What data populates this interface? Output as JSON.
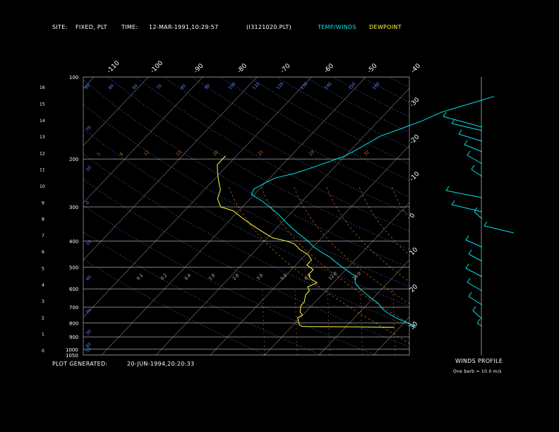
{
  "header": {
    "site_label": "SITE:",
    "site_value": "FIXED, PLT",
    "time_label": "TIME:",
    "time_value": "12-MAR-1991,10:29:57",
    "file": "(I3121020.PLT)",
    "temp_label": "TEMP/WINDS",
    "dew_label": "DEWPOINT"
  },
  "footer": {
    "generated_label": "PLOT GENERATED:",
    "generated_value": "20-JUN-1994,20:20:33"
  },
  "winds": {
    "title": "WINDS PROFILE",
    "note": "One barb = 10.0 m/s"
  },
  "colors": {
    "temp": "#00e5ee",
    "dew": "#ffff40",
    "isobar": "#c8c8c8",
    "isotherm": "#c8c8c8",
    "dry_adiabat": "#5b8cff",
    "moist_adiabat": "#d2691e",
    "mixing_ratio": "#d2691e",
    "background": "#000000"
  },
  "chart_data": {
    "type": "line",
    "title": "",
    "xlabel": "",
    "ylabel": "",
    "y_scale": "log-pressure",
    "pressure_levels": [
      100,
      200,
      300,
      400,
      500,
      600,
      700,
      800,
      900,
      1000,
      1050
    ],
    "height_ticks": [
      "0",
      "1",
      "2",
      "3",
      "4",
      "5",
      "6",
      "7",
      "8",
      "9",
      "10",
      "11",
      "12",
      "13",
      "14",
      "15",
      "16"
    ],
    "top_temp_ticks": [
      "-110",
      "-100",
      "-90",
      "-80",
      "-70",
      "-60",
      "-50",
      "-40"
    ],
    "right_temp_ticks": [
      "-30",
      "-20",
      "-10",
      "0",
      "10",
      "20",
      "30"
    ],
    "dry_adiabat_labels": [
      "90",
      "80",
      "60",
      "70",
      "80",
      "90",
      "100",
      "110",
      "120",
      "130",
      "140",
      "150",
      "160"
    ],
    "moist_adiabat_labels": [
      "5",
      "8",
      "12",
      "15",
      "20",
      "25",
      "29",
      "32"
    ],
    "mixing_ratio_labels": [
      "0.1",
      "0.2",
      "0.4",
      "1.0",
      "2.0",
      "3.0",
      "5.0",
      "8.0",
      "12.0",
      "20.0"
    ],
    "series": [
      {
        "name": "TEMP/WINDS",
        "pressure": [
          830,
          828,
          822,
          815,
          808,
          800,
          792,
          782,
          765,
          745,
          725,
          700,
          680,
          660,
          640,
          620,
          600,
          585,
          570,
          555,
          540,
          520,
          500,
          480,
          460,
          440,
          420,
          400,
          380,
          360,
          340,
          320,
          300,
          285,
          270,
          258,
          245,
          235,
          225,
          215,
          205,
          195,
          185,
          175,
          165,
          155,
          145,
          135,
          125,
          118
        ],
        "temperature": [
          -7,
          -7.5,
          -7.5,
          -8,
          -8.5,
          -9.5,
          -10,
          -11,
          -12.5,
          -14,
          -15.5,
          -17,
          -18,
          -19.5,
          -21,
          -22.5,
          -24,
          -25,
          -26,
          -26.5,
          -27,
          -29,
          -31,
          -33,
          -35,
          -37.5,
          -40,
          -42,
          -44.5,
          -47,
          -49.5,
          -52,
          -55,
          -57.5,
          -60.5,
          -61,
          -60,
          -59,
          -56,
          -54,
          -52,
          -50,
          -49,
          -48,
          -47,
          -44.5,
          -42,
          -40,
          -36,
          -33
        ]
      },
      {
        "name": "DEWPOINT",
        "pressure": [
          830,
          828,
          825,
          820,
          810,
          795,
          780,
          765,
          750,
          730,
          710,
          690,
          670,
          650,
          630,
          610,
          590,
          570,
          550,
          530,
          510,
          500,
          490,
          470,
          450,
          430,
          410,
          400,
          390,
          370,
          350,
          330,
          310,
          300,
          280,
          260,
          240,
          230,
          220,
          210,
          200,
          195
        ],
        "temperature": [
          -11,
          -16,
          -28,
          -28.5,
          -29,
          -29.5,
          -30,
          -30.5,
          -30,
          -31,
          -31.5,
          -32,
          -32,
          -32.5,
          -33,
          -33,
          -34,
          -33,
          -35,
          -36,
          -36,
          -37,
          -38,
          -38,
          -39.5,
          -42,
          -44,
          -46,
          -49,
          -52,
          -55,
          -58,
          -61,
          -64,
          -66,
          -67,
          -69,
          -70,
          -71,
          -72,
          -72,
          -72
        ]
      }
    ]
  }
}
